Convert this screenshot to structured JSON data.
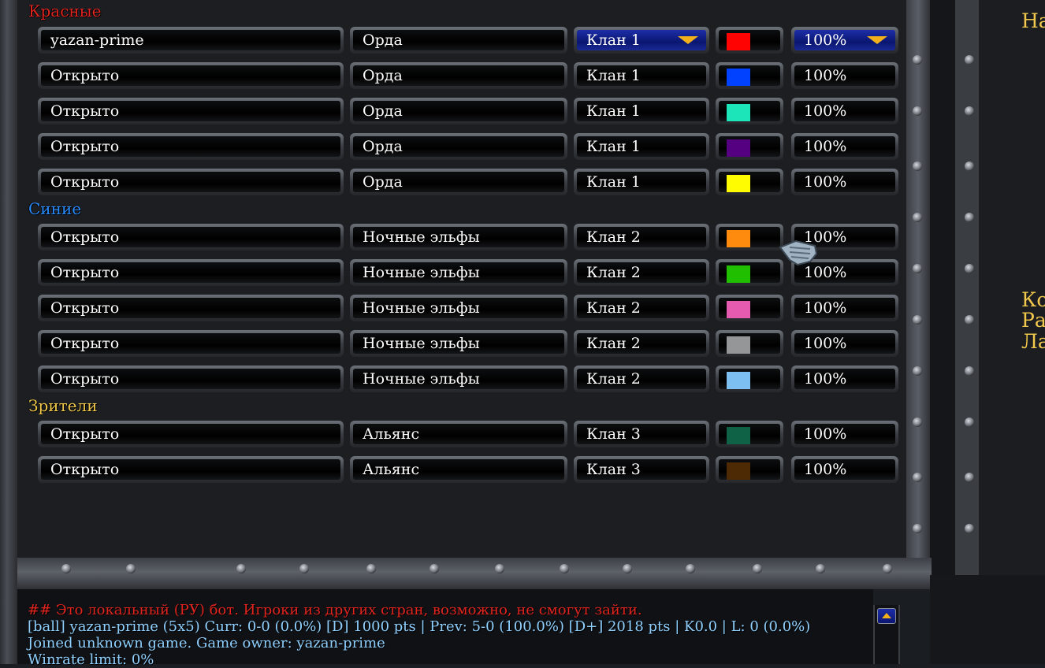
{
  "teams": [
    {
      "label": "Красные",
      "color": "#e0241e",
      "slots": [
        {
          "player": "yazan-prime",
          "race": "Орда",
          "clan": "Клан 1",
          "color": "#ff0303",
          "handicap": "100%",
          "active": true
        },
        {
          "player": "Открыто",
          "race": "Орда",
          "clan": "Клан 1",
          "color": "#0042ff",
          "handicap": "100%"
        },
        {
          "player": "Открыто",
          "race": "Орда",
          "clan": "Клан 1",
          "color": "#1ce6b9",
          "handicap": "100%"
        },
        {
          "player": "Открыто",
          "race": "Орда",
          "clan": "Клан 1",
          "color": "#540081",
          "handicap": "100%"
        },
        {
          "player": "Открыто",
          "race": "Орда",
          "clan": "Клан 1",
          "color": "#fffc01",
          "handicap": "100%"
        }
      ]
    },
    {
      "label": "Синие",
      "color": "#2a8cff",
      "slots": [
        {
          "player": "Открыто",
          "race": "Ночные эльфы",
          "clan": "Клан 2",
          "color": "#fe8a0e",
          "handicap": "100%"
        },
        {
          "player": "Открыто",
          "race": "Ночные эльфы",
          "clan": "Клан 2",
          "color": "#20c000",
          "handicap": "100%"
        },
        {
          "player": "Открыто",
          "race": "Ночные эльфы",
          "clan": "Клан 2",
          "color": "#e55bb0",
          "handicap": "100%"
        },
        {
          "player": "Открыто",
          "race": "Ночные эльфы",
          "clan": "Клан 2",
          "color": "#959697",
          "handicap": "100%"
        },
        {
          "player": "Открыто",
          "race": "Ночные эльфы",
          "clan": "Клан 2",
          "color": "#7ebff1",
          "handicap": "100%"
        }
      ]
    },
    {
      "label": "Зрители",
      "color": "#f2c94c",
      "slots": [
        {
          "player": "Открыто",
          "race": "Альянс",
          "clan": "Клан 3",
          "color": "#106246",
          "handicap": "100%"
        },
        {
          "player": "Открыто",
          "race": "Альянс",
          "clan": "Клан 3",
          "color": "#4e2a04",
          "handicap": "100%"
        }
      ]
    }
  ],
  "right_panel": {
    "lines": [
      "На",
      "Ко",
      "Ра",
      "Ла"
    ]
  },
  "chat": {
    "lines": [
      {
        "text": "## Это локальный (РУ) бот. Игроки из других стран, возможно, не смогут зайти.",
        "color": "#e0241e"
      },
      {
        "text": "[ball] yazan-prime (5x5) Curr: 0-0 (0.0%) [D] 1000 pts | Prev: 5-0 (100.0%) [D+] 2018 pts | K0.0 | L: 0 (0.0%)",
        "color": "#8fd0ff"
      },
      {
        "text": "Joined unknown game. Game owner: yazan-prime",
        "color": "#8fd0ff"
      },
      {
        "text": "Winrate limit: 0%",
        "color": "#8fd0ff"
      }
    ]
  }
}
